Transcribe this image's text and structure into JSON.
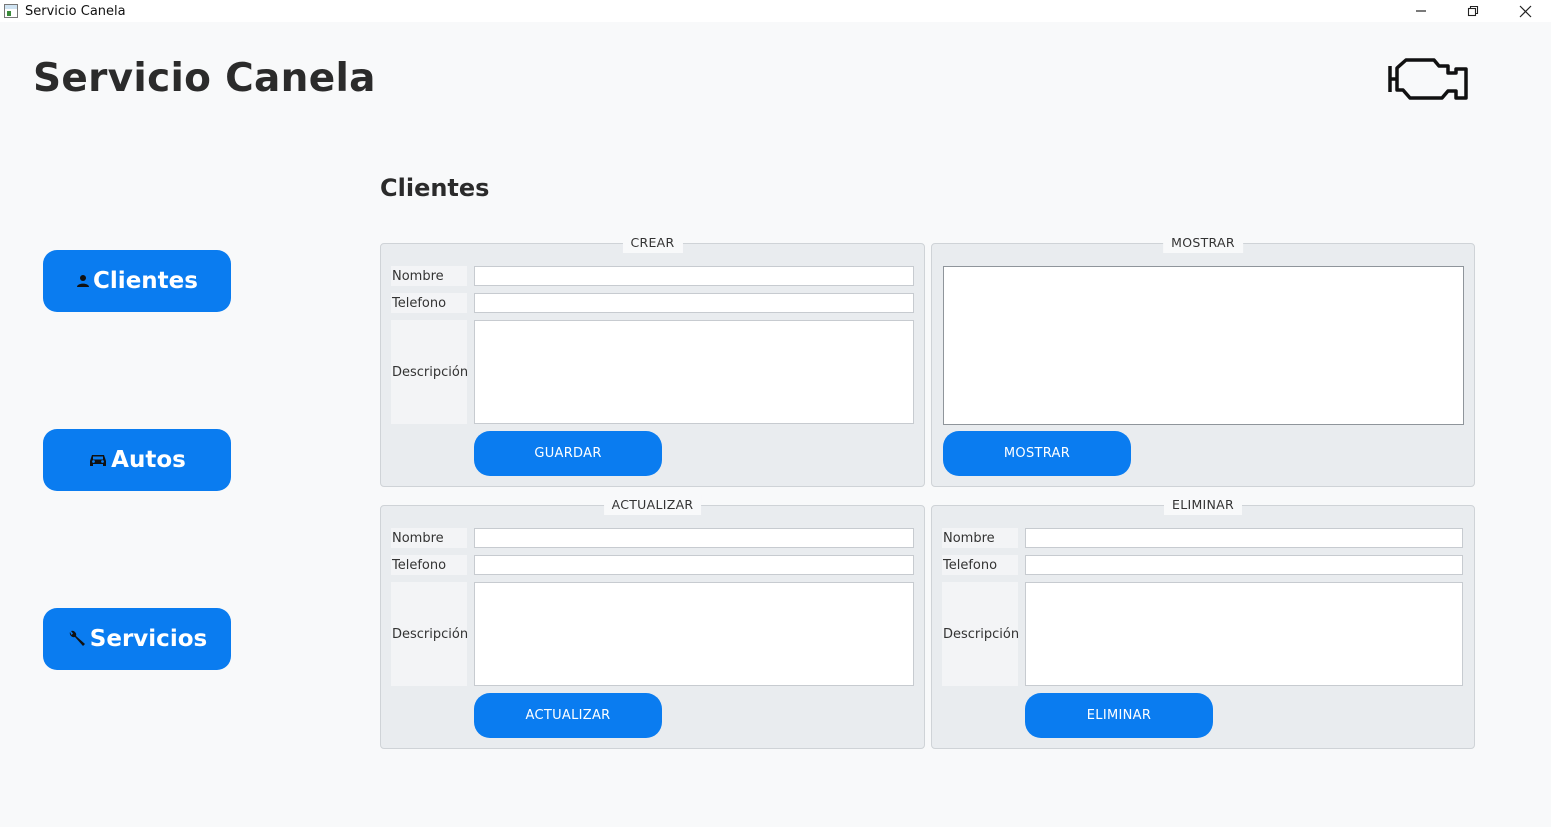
{
  "window": {
    "title": "Servicio Canela",
    "controls": {
      "minimize_icon": "minimize-icon",
      "restore_icon": "restore-icon",
      "close_icon": "close-icon"
    }
  },
  "header": {
    "title": "Servicio Canela",
    "logo_icon": "engine-icon"
  },
  "nav": {
    "items": [
      {
        "label": "Clientes",
        "icon": "person-icon"
      },
      {
        "label": "Autos",
        "icon": "car-icon"
      },
      {
        "label": "Servicios",
        "icon": "wrench-icon"
      }
    ]
  },
  "section": {
    "title": "Clientes"
  },
  "panels": {
    "crear": {
      "legend": "CREAR",
      "nombre_label": "Nombre",
      "telefono_label": "Telefono",
      "descripcion_label": "Descripción",
      "nombre_value": "",
      "telefono_value": "",
      "descripcion_value": "",
      "button": "GUARDAR"
    },
    "mostrar": {
      "legend": "MOSTRAR",
      "display_value": "",
      "button": "MOSTRAR"
    },
    "actualizar": {
      "legend": "ACTUALIZAR",
      "nombre_label": "Nombre",
      "telefono_label": "Telefono",
      "descripcion_label": "Descripción",
      "nombre_value": "",
      "telefono_value": "",
      "descripcion_value": "",
      "button": "ACTUALIZAR"
    },
    "eliminar": {
      "legend": "ELIMINAR",
      "nombre_label": "Nombre",
      "telefono_label": "Telefono",
      "descripcion_label": "Descripción",
      "nombre_value": "",
      "telefono_value": "",
      "descripcion_value": "",
      "button": "ELIMINAR"
    }
  },
  "colors": {
    "accent": "#0a7cf0",
    "background": "#f8f9fa",
    "panel": "#e9ecef"
  }
}
